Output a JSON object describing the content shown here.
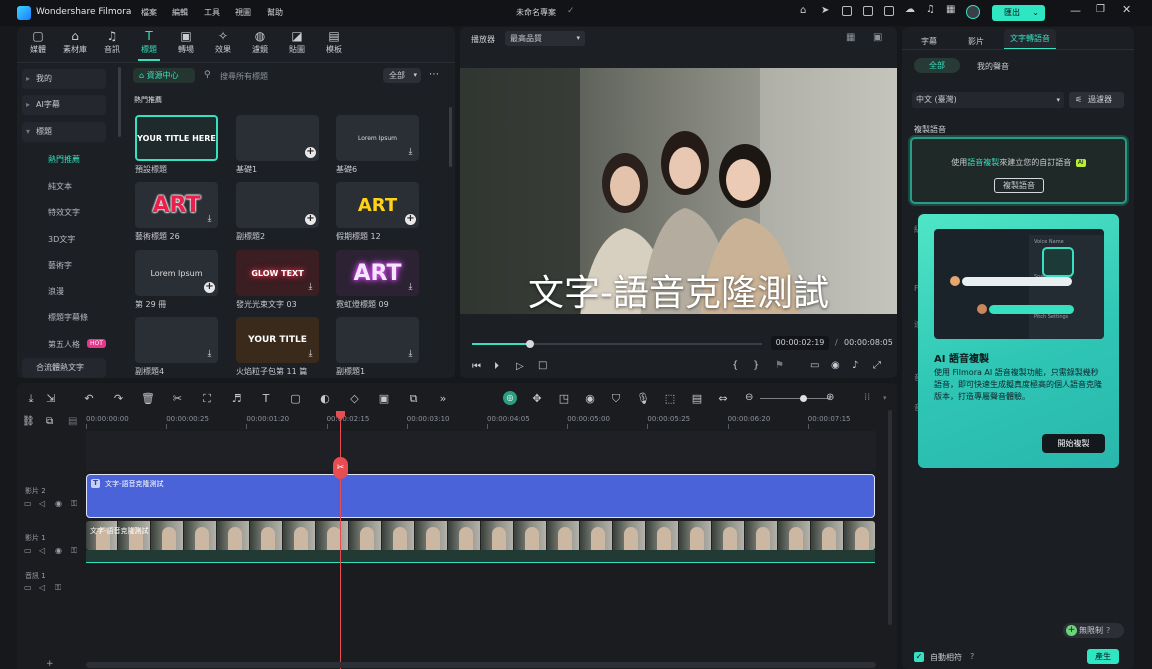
{
  "app": {
    "name": "Wondershare Filmora",
    "project_title": "未命名專案",
    "menus": [
      "檔案",
      "編輯",
      "工具",
      "視圖",
      "幫助"
    ],
    "export_label": "匯出"
  },
  "media_tabs": [
    {
      "label": "媒體",
      "icon": "media-icon"
    },
    {
      "label": "素材庫",
      "icon": "store-icon"
    },
    {
      "label": "音訊",
      "icon": "music-icon"
    },
    {
      "label": "標題",
      "icon": "title-icon"
    },
    {
      "label": "轉場",
      "icon": "transition-icon"
    },
    {
      "label": "效果",
      "icon": "effects-icon"
    },
    {
      "label": "濾鏡",
      "icon": "filter-icon"
    },
    {
      "label": "貼圖",
      "icon": "sticker-icon"
    },
    {
      "label": "模板",
      "icon": "template-icon"
    }
  ],
  "sidebar": {
    "items": [
      {
        "label": "我的"
      },
      {
        "label": "AI字幕"
      },
      {
        "label": "標題"
      }
    ],
    "subitems": [
      "熱門推薦",
      "純文本",
      "特效文字",
      "3D文字",
      "藝術字",
      "浪漫",
      "標題字幕條",
      "第五人格",
      "合流體熱文字"
    ],
    "hot_badge": "HOT"
  },
  "library": {
    "center_label": "資源中心",
    "search_placeholder": "搜尋所有標題",
    "filter_label": "全部",
    "section_title": "熱門推薦",
    "items": [
      {
        "label": "預設標題",
        "thumb_text": "YOUR TITLE HERE"
      },
      {
        "label": "基礎1",
        "thumb_text": ""
      },
      {
        "label": "基礎6",
        "thumb_text": "Lorem Ipsum"
      },
      {
        "label": "藝術標題 26",
        "thumb_text": "ART"
      },
      {
        "label": "副標題2",
        "thumb_text": ""
      },
      {
        "label": "假期標題 12",
        "thumb_text": "ART"
      },
      {
        "label": "第 29 冊",
        "thumb_text": "Lorem Ipsum"
      },
      {
        "label": "發光光束文字 03",
        "thumb_text": "GLOW TEXT"
      },
      {
        "label": "霓虹燈標題 09",
        "thumb_text": "ART"
      },
      {
        "label": "副標題4",
        "thumb_text": ""
      },
      {
        "label": "火焰粒子包第 11 篇",
        "thumb_text": "YOUR TITLE"
      },
      {
        "label": "副標題1",
        "thumb_text": ""
      }
    ]
  },
  "player": {
    "label": "播放器",
    "quality": "最高品質",
    "caption": "文字-語音克隆測試",
    "current_time": "00:00:02:19",
    "separator": "/",
    "total_time": "00:00:08:05",
    "progress": 0.2
  },
  "timeline": {
    "ticks": [
      "00:00:00:00",
      "00:00:00:25",
      "00:00:01:20",
      "00:00:02:15",
      "00:00:03:10",
      "00:00:04:05",
      "00:00:05:00",
      "00:00:05:25",
      "00:00:06:20",
      "00:00:07:15"
    ],
    "tracks": [
      {
        "label": "影片 2"
      },
      {
        "label": "影片 1"
      },
      {
        "label": "音訊 1"
      }
    ],
    "title_clip": "文字-語音克隆測試",
    "video_clip": "文字-語音克隆測試"
  },
  "right_panel": {
    "tabs": [
      "字幕",
      "影片",
      "文字轉語音"
    ],
    "subtabs": [
      "全部",
      "我的聲音"
    ],
    "language": "中文 (臺灣)",
    "filter_label": "過濾器",
    "clone_section": "複製語音",
    "clone_text_prefix": "使用",
    "clone_text_link": "語音複製",
    "clone_text_suffix": "來建立您的自訂語音",
    "ai_badge": "AI",
    "clone_button": "複製語音",
    "popup_title": "AI 語音複製",
    "popup_body": "使用 Filmora AI 語音複製功能，只需錄製幾秒語音，即可快速生成擬真度極高的個人語音克隆版本，打造專屬聲音體驗。",
    "popup_button": "開始複製",
    "unlimited_label": "無限制",
    "auto_match_label": "自動相符",
    "generate_label": "產生",
    "popup_mock": {
      "voice_name": "Voice Name",
      "speed": "Speed Settings",
      "pitch": "Pitch Settings"
    }
  },
  "colors": {
    "accent": "#36e0c0",
    "clip_title": "#4a63d8",
    "playhead": "#e84d52",
    "export_bg": "#2ee6c2"
  }
}
